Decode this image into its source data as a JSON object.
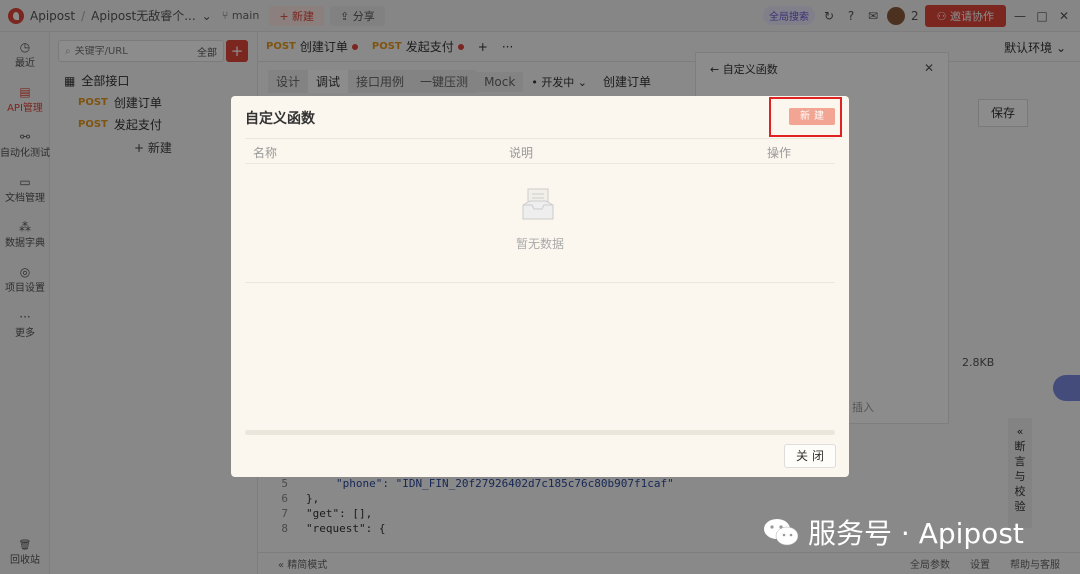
{
  "topbar": {
    "app": "Apipost",
    "separator": "/",
    "project": "Apipost无敌睿个...",
    "branch": "main",
    "new": "+ 新建",
    "share": "分享",
    "global_search": "全局搜索",
    "user_count": "2",
    "invite": "邀请协作"
  },
  "rail": {
    "items": [
      {
        "label": "最近",
        "icon": "clock-icon"
      },
      {
        "label": "API管理",
        "icon": "api-icon"
      },
      {
        "label": "自动化测试",
        "icon": "automation-icon"
      },
      {
        "label": "文档管理",
        "icon": "doc-icon"
      },
      {
        "label": "数据字典",
        "icon": "dictionary-icon"
      },
      {
        "label": "项目设置",
        "icon": "settings-icon"
      },
      {
        "label": "更多",
        "icon": "more-icon"
      }
    ],
    "trash": "回收站"
  },
  "tree": {
    "search_placeholder": "关键字/URL",
    "filter": "全部",
    "all": "全部接口",
    "items": [
      {
        "method": "POST",
        "name": "创建订单"
      },
      {
        "method": "POST",
        "name": "发起支付"
      }
    ],
    "new": "+ 新建"
  },
  "tabs": [
    {
      "method": "POST",
      "name": "创建订单"
    },
    {
      "method": "POST",
      "name": "发起支付"
    }
  ],
  "env": "默认环境",
  "subtabs": [
    "设计",
    "调试",
    "接口用例",
    "一键压测",
    "Mock"
  ],
  "dev_tag": "开发中",
  "subtitle": "创建订单",
  "side_panel": {
    "title": "自定义函数",
    "insert": "插入"
  },
  "save": "保存",
  "size": "2.8KB",
  "vertical_tab": "断言与校验",
  "code": [
    {
      "ln": "5",
      "text": "\"phone\": \"IDN_FIN_20f27926402d7c185c76c80b907f1caf\""
    },
    {
      "ln": "6",
      "text": "},"
    },
    {
      "ln": "7",
      "text": "\"get\": [],"
    },
    {
      "ln": "8",
      "text": "\"request\": {"
    }
  ],
  "bottombar": {
    "left": "精简模式",
    "params": "全局参数",
    "settings": "设置",
    "help": "帮助与客服"
  },
  "dialog": {
    "title": "自定义函数",
    "new_button": "新建",
    "columns": [
      "名称",
      "说明",
      "操作"
    ],
    "empty": "暂无数据",
    "close": "关闭"
  },
  "watermark": "服务号 · Apipost"
}
